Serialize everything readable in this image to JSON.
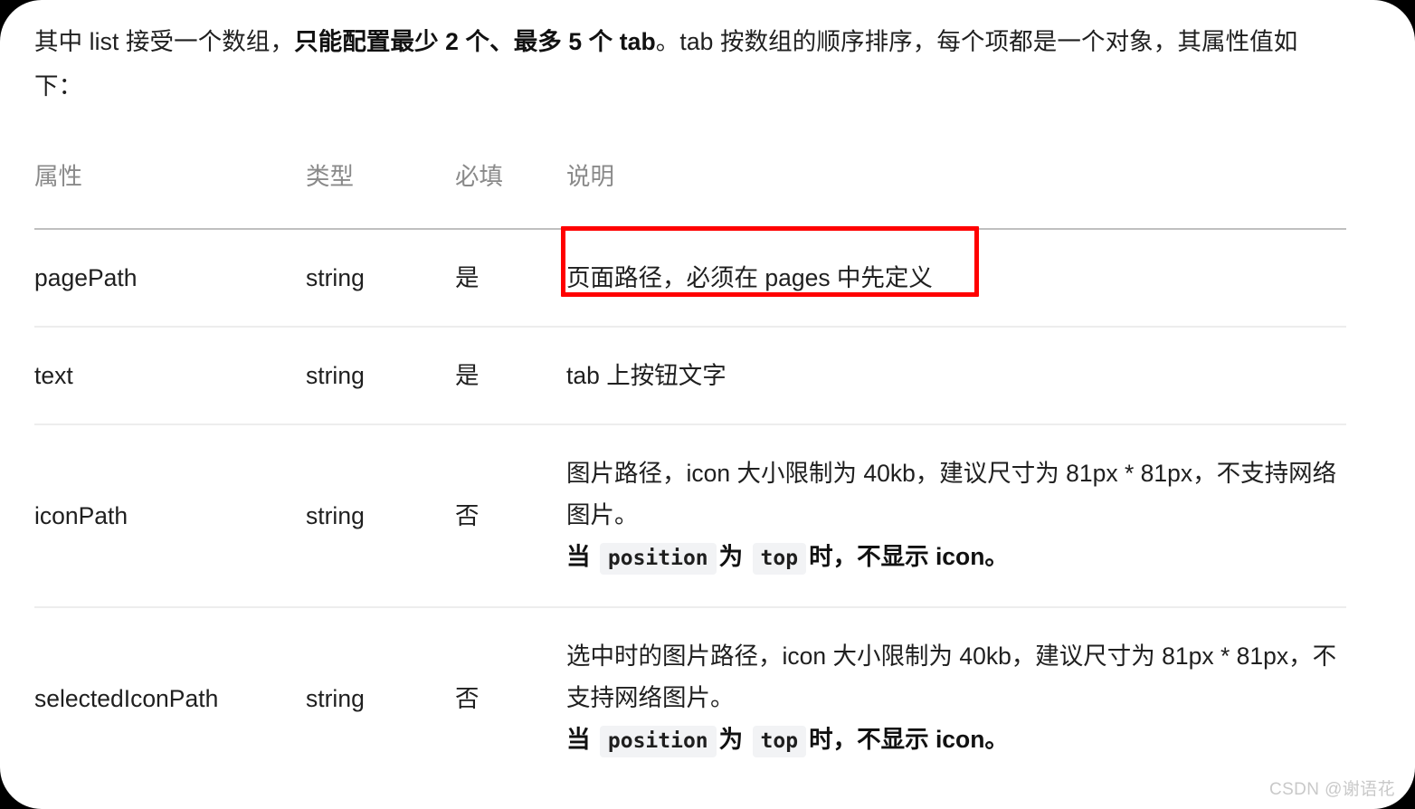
{
  "page": {
    "background_color": "#000000",
    "card_color": "#ffffff",
    "accent_color": "#ff0000"
  },
  "intro": {
    "part1": "其中 list 接受一个数组，",
    "emphasis": "只能配置最少 2 个、最多 5 个 tab",
    "part2": "。tab 按数组的顺序排序，每个项都是一个对象，其属性值如下："
  },
  "table": {
    "headers": [
      "属性",
      "类型",
      "必填",
      "说明"
    ],
    "rows": [
      {
        "attr": "pagePath",
        "type": "string",
        "required": "是",
        "desc_lines": [
          {
            "text": "页面路径，必须在 pages 中先定义",
            "bold": false
          }
        ],
        "highlighted": true
      },
      {
        "attr": "text",
        "type": "string",
        "required": "是",
        "desc_lines": [
          {
            "text": "tab 上按钮文字",
            "bold": false
          }
        ],
        "highlighted": false
      },
      {
        "attr": "iconPath",
        "type": "string",
        "required": "否",
        "desc_lines": [
          {
            "text": "图片路径，icon 大小限制为 40kb，建议尺寸为 81px * 81px，不支持网络图片。",
            "bold": false
          },
          {
            "text": "当 position 为 top 时，不显示 icon。",
            "bold": true,
            "code_parts": [
              "position",
              "top"
            ]
          }
        ],
        "highlighted": false
      },
      {
        "attr": "selectedIconPath",
        "type": "string",
        "required": "否",
        "desc_lines": [
          {
            "text": "选中时的图片路径，icon 大小限制为 40kb，建议尺寸为 81px * 81px，不支持网络图片。",
            "bold": false
          },
          {
            "text": "当 position 为 top 时，不显示 icon。",
            "bold": true,
            "code_parts": [
              "position",
              "top"
            ]
          }
        ],
        "highlighted": false
      }
    ]
  },
  "annotation": {
    "type": "red-rectangle",
    "target": "pagePath 说明单元格"
  },
  "watermark": {
    "text": "CSDN @谢语花"
  },
  "fragments": {
    "dang": "当",
    "wei": "为",
    "shi_bu_xian_shi": "时，不显示 icon。",
    "code_position": "position",
    "code_top": "top",
    "icon_desc_line1": "图片路径，icon 大小限制为 40kb，建议尺寸为 81px * 81px，不支",
    "icon_desc_line1b": "持网络图片。",
    "sel_desc_line1": "选中时的图片路径，icon 大小限制为 40kb，建议尺寸为 81px *",
    "sel_desc_line1b": "81px，不支持网络图片。"
  }
}
